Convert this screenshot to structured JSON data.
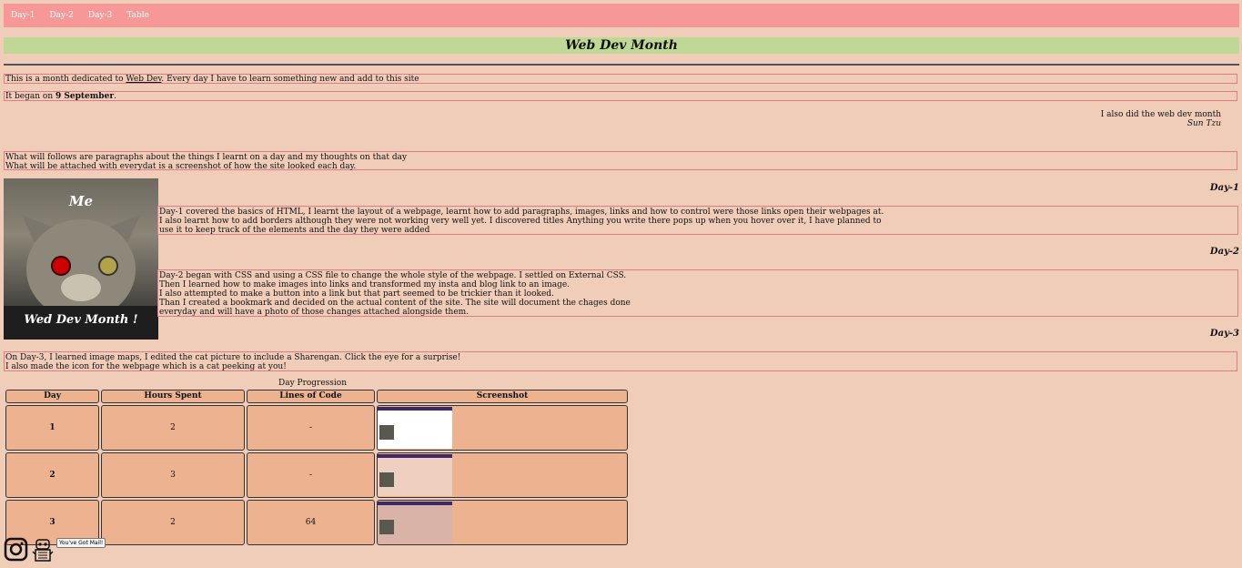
{
  "nav": {
    "items": [
      "Day-1",
      "Day-2",
      "Day-3",
      "Table"
    ]
  },
  "banner": {
    "title": "Web Dev Month"
  },
  "intro": {
    "line1_pre": "This is a month dedicated to ",
    "line1_link": "Web Dev",
    "line1_post": ". Every day I have to learn something new and add to this site",
    "line2_pre": "It began on ",
    "line2_bold": "9 September",
    "line2_post": "."
  },
  "quote": {
    "text": "I also did the web dev month",
    "author": "Sun Tzu"
  },
  "follow": {
    "line1": "What will follows are paragraphs about the things I learnt on a day and my thoughts on that day",
    "line2": "What will be attached with everydat is a screenshot of how the site looked each day."
  },
  "cat_image": {
    "top_text": "Me",
    "bottom_text": "Wed Dev Month !"
  },
  "days": [
    {
      "heading": "Day-1",
      "lines": [
        "Day-1 covered the basics of HTML, I learnt the layout of a webpage, learnt how to add paragraphs, images, links and how to control were those links open their webpages at.",
        "I also learnt how to add borders although they were not working very well yet. I discovered titles Anything you write there pops up when you hover over it, I have planned to",
        "use it to keep track of the elements and the day they were added"
      ]
    },
    {
      "heading": "Day-2",
      "lines": [
        "Day-2 began with CSS and using a CSS file to change the whole style of the webpage. I settled on External CSS.",
        "Then I learned how to make images into links and transformed my insta and blog link to an image.",
        "I also attempted to make a button into a link but that part seemed to be trickier than it looked.",
        "Than I created a bookmark and decided on the actual content of the site. The site will document the chages done",
        "everyday and will have a photo of those changes attached alongside them."
      ]
    },
    {
      "heading": "Day-3",
      "lines": [
        "On Day-3, I learned image maps, I edited the cat picture to include a Sharengan. Click the eye for a surprise!",
        "I also made the icon for the webpage which is a cat peeking at you!"
      ]
    }
  ],
  "table": {
    "caption": "Day Progression",
    "headers": [
      "Day",
      "Hours Spent",
      "Lines of Code",
      "Screenshot"
    ],
    "rows": [
      {
        "day": "1",
        "hours": "2",
        "lines": "-"
      },
      {
        "day": "2",
        "hours": "3",
        "lines": "-"
      },
      {
        "day": "3",
        "hours": "2",
        "lines": "64"
      }
    ]
  },
  "footer": {
    "mail_button": "You've Got Mail!",
    "icons": [
      "instagram-icon",
      "blog-robot-icon"
    ]
  },
  "colors": {
    "nav": "#f79898",
    "banner": "#c0d895",
    "background": "#f0cdb9",
    "table_cell": "#edb290",
    "box_border": "#e27a88"
  }
}
